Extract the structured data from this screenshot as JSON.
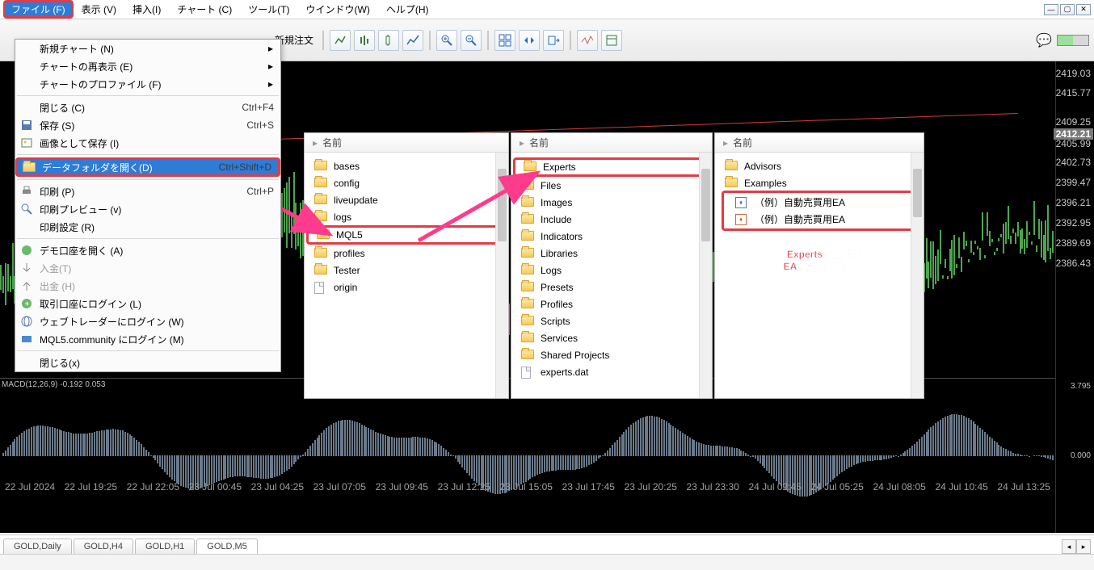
{
  "menubar": {
    "items": [
      {
        "label": "ファイル (F)",
        "highlighted": true
      },
      {
        "label": "表示 (V)"
      },
      {
        "label": "挿入(I)"
      },
      {
        "label": "チャート (C)"
      },
      {
        "label": "ツール(T)"
      },
      {
        "label": "ウインドウ(W)"
      },
      {
        "label": "ヘルプ(H)"
      }
    ]
  },
  "toolbar": {
    "new_order": "新規注文"
  },
  "dropdown": {
    "items": [
      {
        "label": "新規チャート (N)",
        "submenu": true
      },
      {
        "label": "チャートの再表示 (E)",
        "submenu": true
      },
      {
        "label": "チャートのプロファイル (F)",
        "submenu": true
      },
      {
        "sep": true
      },
      {
        "label": "閉じる (C)",
        "shortcut": "Ctrl+F4"
      },
      {
        "label": "保存 (S)",
        "shortcut": "Ctrl+S",
        "icon": "save"
      },
      {
        "label": "画像として保存 (I)",
        "icon": "image"
      },
      {
        "sep": true
      },
      {
        "label": "データフォルダを開く(D)",
        "shortcut": "Ctrl+Shift+D",
        "icon": "folder",
        "selected": true,
        "boxed": true
      },
      {
        "sep": true
      },
      {
        "label": "印刷 (P)",
        "shortcut": "Ctrl+P",
        "icon": "print"
      },
      {
        "label": "印刷プレビュー (v)",
        "icon": "preview"
      },
      {
        "label": "印刷設定 (R)"
      },
      {
        "sep": true
      },
      {
        "label": "デモ口座を開く (A)",
        "icon": "demo"
      },
      {
        "label": "入金(T)",
        "disabled": true,
        "icon": "deposit"
      },
      {
        "label": "出金 (H)",
        "disabled": true,
        "icon": "withdraw"
      },
      {
        "label": "取引口座にログイン (L)",
        "icon": "login"
      },
      {
        "label": "ウェブトレーダーにログイン (W)",
        "icon": "web"
      },
      {
        "label": "MQL5.community にログイン (M)",
        "icon": "mql5"
      },
      {
        "sep": true
      },
      {
        "label": "閉じる(x)"
      }
    ]
  },
  "explorer1": {
    "header": "名前",
    "items": [
      {
        "label": "bases",
        "type": "folder"
      },
      {
        "label": "config",
        "type": "folder"
      },
      {
        "label": "liveupdate",
        "type": "folder"
      },
      {
        "label": "logs",
        "type": "folder"
      },
      {
        "label": "MQL5",
        "type": "folder",
        "boxed": true
      },
      {
        "label": "profiles",
        "type": "folder"
      },
      {
        "label": "Tester",
        "type": "folder"
      },
      {
        "label": "origin",
        "type": "file"
      }
    ]
  },
  "explorer2": {
    "header": "名前",
    "items": [
      {
        "label": "Experts",
        "type": "folder",
        "boxed": true
      },
      {
        "label": "Files",
        "type": "folder"
      },
      {
        "label": "Images",
        "type": "folder"
      },
      {
        "label": "Include",
        "type": "folder"
      },
      {
        "label": "Indicators",
        "type": "folder"
      },
      {
        "label": "Libraries",
        "type": "folder"
      },
      {
        "label": "Logs",
        "type": "folder"
      },
      {
        "label": "Presets",
        "type": "folder"
      },
      {
        "label": "Profiles",
        "type": "folder"
      },
      {
        "label": "Scripts",
        "type": "folder"
      },
      {
        "label": "Services",
        "type": "folder"
      },
      {
        "label": "Shared Projects",
        "type": "folder"
      },
      {
        "label": "experts.dat",
        "type": "file"
      }
    ]
  },
  "explorer3": {
    "header": "名前",
    "items_pre": [
      {
        "label": "Advisors",
        "type": "folder"
      },
      {
        "label": "Examples",
        "type": "folder"
      }
    ],
    "items_boxed": [
      {
        "label": "（例）自動売買用EA",
        "type": "ea-b"
      },
      {
        "label": "（例）自動売買用EA",
        "type": "ea-r"
      }
    ]
  },
  "callout": {
    "line1": "「Experts」直下が",
    "line2": "EAの格納場所。"
  },
  "prices": {
    "ticks": [
      "2419.03",
      "2415.77",
      "2409.25",
      "2405.99",
      "2402.73",
      "2399.47",
      "2396.21",
      "2392.95",
      "2389.69",
      "2386.43"
    ],
    "current": "2412.21"
  },
  "macd": {
    "label": "MACD(12,26,9) -0.192 0.053",
    "top": "3.795",
    "zero": "0.000"
  },
  "times": [
    "22 Jul 2024",
    "22 Jul 19:25",
    "22 Jul 22:05",
    "23 Jul 00:45",
    "23 Jul 04:25",
    "23 Jul 07:05",
    "23 Jul 09:45",
    "23 Jul 12:25",
    "23 Jul 15:05",
    "23 Jul 17:45",
    "23 Jul 20:25",
    "23 Jul 23:30",
    "24 Jul 02:45",
    "24 Jul 05:25",
    "24 Jul 08:05",
    "24 Jul 10:45",
    "24 Jul 13:25"
  ],
  "tabs": [
    {
      "label": "GOLD,Daily"
    },
    {
      "label": "GOLD,H4"
    },
    {
      "label": "GOLD,H1"
    },
    {
      "label": "GOLD,M5",
      "active": true
    }
  ]
}
